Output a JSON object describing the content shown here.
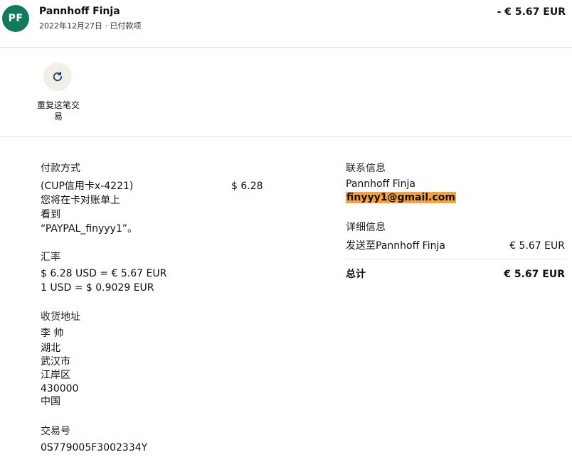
{
  "header": {
    "avatar_initials": "PF",
    "name": "Pannhoff Finja",
    "date_status": "2022年12月27日 · 已付款项",
    "amount": "- € 5.67 EUR"
  },
  "actions": {
    "repeat_label_line1": "重复这笔交",
    "repeat_label_line2": "易"
  },
  "payment": {
    "heading": "付款方式",
    "card": "(CUP信用卡x-4221)",
    "card_amount": "$ 6.28",
    "note_line1": "您将在卡对账单上",
    "note_line2": "看到",
    "note_line3": "“PAYPAL_finyyy1”。"
  },
  "exchange": {
    "heading": "汇率",
    "line1": "$ 6.28 USD = € 5.67 EUR",
    "line2": "1 USD = $ 0.9029 EUR"
  },
  "shipping": {
    "heading": "收货地址",
    "name": "李 帅",
    "province": "湖北",
    "city": "武汉市",
    "district": "江岸区",
    "postcode": "430000",
    "country": "中国"
  },
  "transaction": {
    "heading": "交易号",
    "id": "0S779005F3002334Y"
  },
  "contact": {
    "heading": "联系信息",
    "name": "Pannhoff Finja",
    "email": "finyyy1@gmail.com"
  },
  "details": {
    "heading": "详细信息",
    "send_to": "发送至Pannhoff Finja",
    "send_amount": "€ 5.67 EUR",
    "total_label": "总计",
    "total_amount": "€ 5.67 EUR"
  },
  "colors": {
    "avatar_bg": "#0f7a5f",
    "email_highlight": "#f5a142"
  }
}
